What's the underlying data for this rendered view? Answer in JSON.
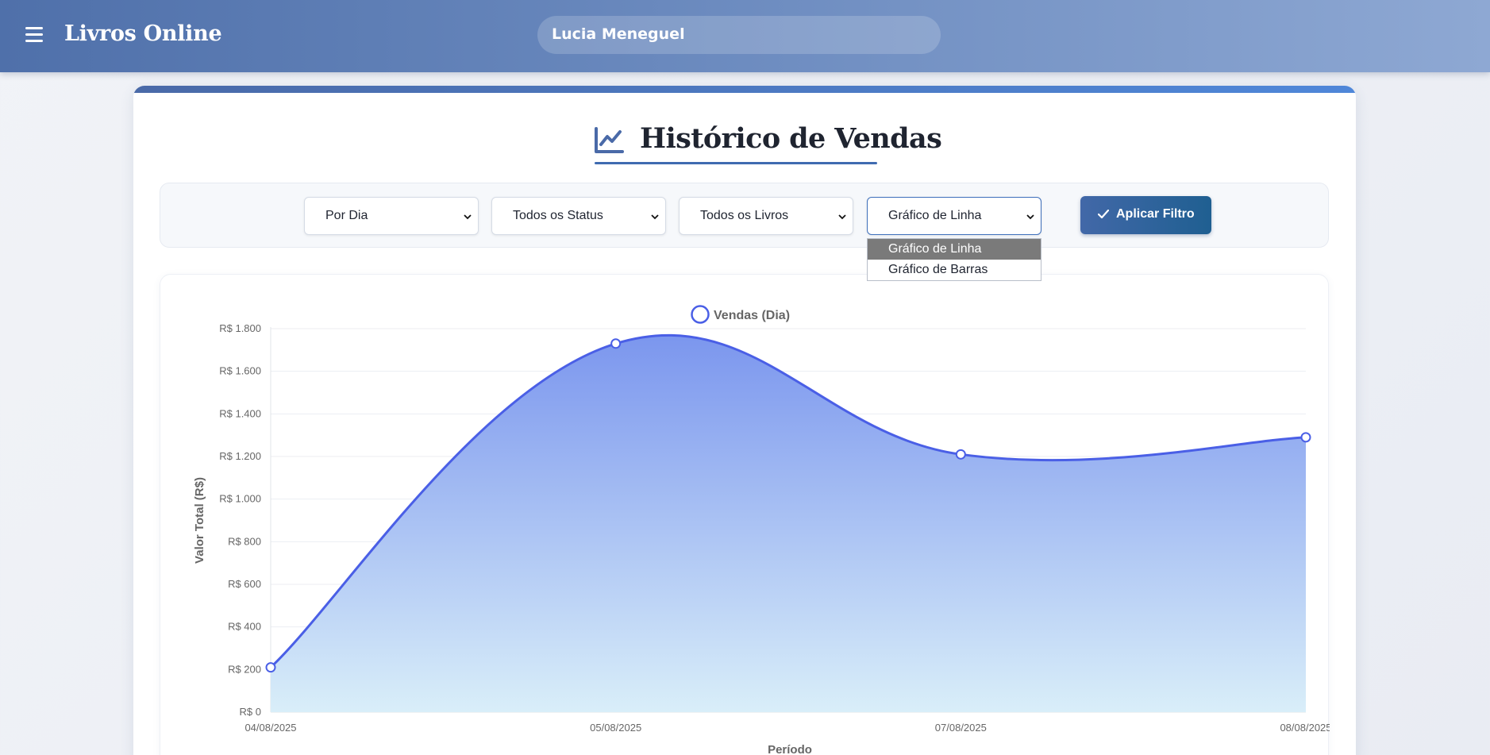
{
  "header": {
    "brand": "Livros Online",
    "user_name": "Lucia Meneguel"
  },
  "page": {
    "title": "Histórico de Vendas"
  },
  "filters": {
    "period": "Por Dia",
    "status": "Todos os Status",
    "books": "Todos os Livros",
    "chart_type": "Gráfico de Linha",
    "apply_label": "Aplicar Filtro",
    "chart_type_options": [
      "Gráfico de Linha",
      "Gráfico de Barras"
    ],
    "chart_type_selected_index": 0
  },
  "chart_data": {
    "type": "line",
    "x": [
      "04/08/2025",
      "05/08/2025",
      "07/08/2025",
      "08/08/2025"
    ],
    "series": [
      {
        "name": "Vendas (Dia)",
        "values": [
          210,
          1730,
          1210,
          1290
        ]
      }
    ],
    "xlabel": "Período",
    "ylabel": "Valor Total (R$)",
    "ylim": [
      0,
      1800
    ],
    "yticks": [
      0,
      200,
      400,
      600,
      800,
      1000,
      1200,
      1400,
      1600,
      1800
    ],
    "ytick_labels": [
      "R$ 0",
      "R$ 200",
      "R$ 400",
      "R$ 600",
      "R$ 800",
      "R$ 1.000",
      "R$ 1.200",
      "R$ 1.400",
      "R$ 1.600",
      "R$ 1.800"
    ],
    "legend_position": "top-center",
    "grid": true,
    "fill": "area-gradient",
    "colors": {
      "line": "#4a5fe6",
      "fill_top": "#7b96ee",
      "fill_bottom": "#d9eef9"
    }
  }
}
